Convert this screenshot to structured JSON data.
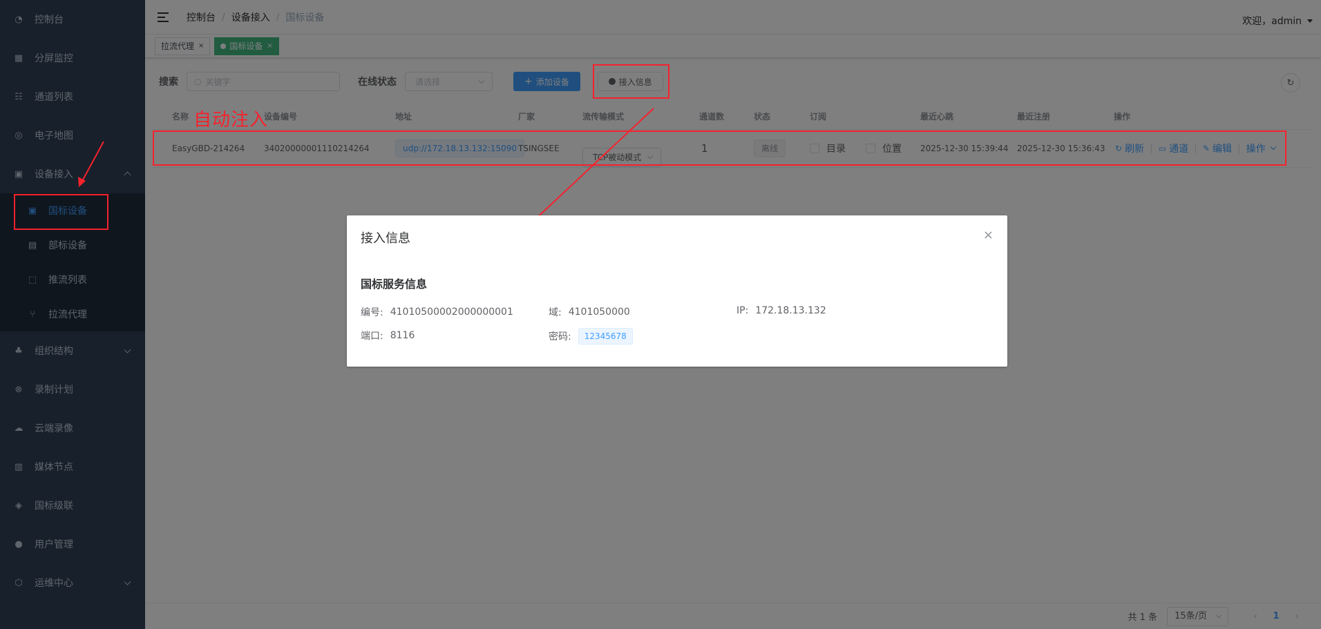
{
  "sidebar": {
    "items": [
      {
        "label": "控制台",
        "icon": "dashboard-icon"
      },
      {
        "label": "分屏监控",
        "icon": "grid-icon"
      },
      {
        "label": "通道列表",
        "icon": "sliders-icon"
      },
      {
        "label": "电子地图",
        "icon": "map-pin-icon"
      },
      {
        "label": "设备接入",
        "icon": "device-icon"
      },
      {
        "label": "组织结构",
        "icon": "org-tree-icon"
      },
      {
        "label": "录制计划",
        "icon": "record-icon"
      },
      {
        "label": "云端录像",
        "icon": "cloud-icon"
      },
      {
        "label": "媒体节点",
        "icon": "server-icon"
      },
      {
        "label": "国标级联",
        "icon": "layers-icon"
      },
      {
        "label": "用户管理",
        "icon": "user-icon"
      },
      {
        "label": "运维中心",
        "icon": "settings-icon"
      }
    ],
    "submenu": [
      {
        "label": "国标设备",
        "icon": "camera-icon"
      },
      {
        "label": "部标设备",
        "icon": "bus-icon"
      },
      {
        "label": "推流列表",
        "icon": "push-icon"
      },
      {
        "label": "拉流代理",
        "icon": "proxy-icon"
      }
    ]
  },
  "header": {
    "breadcrumb": [
      "控制台",
      "设备接入",
      "国标设备"
    ],
    "separator": "/",
    "welcome": "欢迎，admin"
  },
  "tags": [
    {
      "label": "拉流代理",
      "close": "×"
    },
    {
      "label": "国标设备",
      "close": "×"
    }
  ],
  "toolbar": {
    "search_label": "搜索",
    "search_placeholder": "关键字",
    "status_label": "在线状态",
    "status_placeholder": "请选择",
    "add_button": "添加设备",
    "add_icon": "+",
    "access_button": "接入信息"
  },
  "table": {
    "headers": [
      "名称",
      "设备编号",
      "地址",
      "厂家",
      "流传输模式",
      "通道数",
      "状态",
      "订阅",
      "最近心跳",
      "最近注册",
      "操作"
    ],
    "rows": [
      {
        "name": "EasyGBD-214264",
        "device_id": "34020000001110214264",
        "address": "udp://172.18.13.132:15090",
        "vendor": "TSINGSEE",
        "mode": "TCP被动模式",
        "channels": "1",
        "status": "离线",
        "sub_catalog": "目录",
        "sub_position": "位置",
        "heartbeat": "2025-12-30 15:39:44",
        "register": "2025-12-30 15:36:43",
        "ops": [
          "刷新",
          "通道",
          "编辑",
          "操作"
        ]
      }
    ]
  },
  "pagination": {
    "total": "共 1 条",
    "page_size": "15条/页",
    "current": "1",
    "prev": "‹",
    "next": "›"
  },
  "annotation": {
    "text": "自动注入",
    "color": "#f5222d"
  },
  "dialog": {
    "title": "接入信息",
    "close": "×",
    "section": "国标服务信息",
    "id_label": "编号:",
    "id_value": "41010500002000000001",
    "domain_label": "域:",
    "domain_value": "4101050000",
    "ip_label": "IP:",
    "ip_value": "172.18.13.132",
    "port_label": "端口:",
    "port_value": "8116",
    "pwd_label": "密码:",
    "pwd_value": "12345678"
  },
  "colors": {
    "sidebar_bg": "#304156",
    "sidebar_sub_bg": "#1f2d3d",
    "primary": "#409eff",
    "tag_active": "#42b983",
    "annotation_red": "#f5222d"
  }
}
